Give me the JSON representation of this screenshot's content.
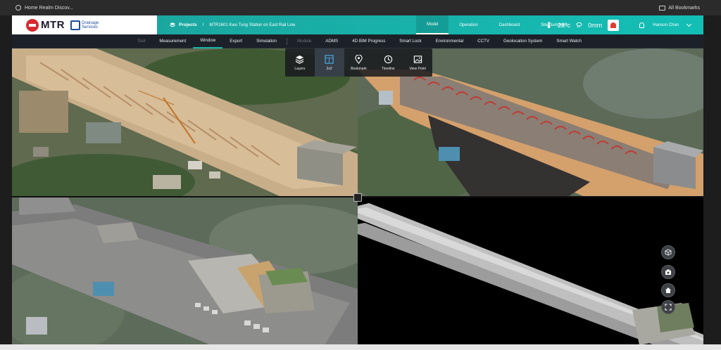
{
  "browser": {
    "bookmark_label": "Home Realm Discov...",
    "all_bookmarks_label": "All Bookmarks"
  },
  "header": {
    "brand": "MTR",
    "dept_logo_text": "Drainage Services",
    "breadcrumb_projects": "Projects",
    "breadcrumb_project": "MTR1601 Kwu Tung Station on East Rail Line",
    "nav": [
      {
        "label": "Model",
        "active": true
      },
      {
        "label": "Operation",
        "active": false
      },
      {
        "label": "Dashboard",
        "active": false
      },
      {
        "label": "Site Summary",
        "active": false
      }
    ],
    "temperature": "28°c",
    "rainfall": "0mm",
    "user_name": "Hanson Chan"
  },
  "submenu": [
    {
      "label": "Tool",
      "dim": true
    },
    {
      "label": "Measurement",
      "dim": false
    },
    {
      "label": "Window",
      "dim": false,
      "active": true
    },
    {
      "label": "Export",
      "dim": false
    },
    {
      "label": "Simulation",
      "dim": false
    },
    {
      "label": "Module",
      "dim": true
    },
    {
      "label": "ADMS",
      "dim": false
    },
    {
      "label": "4D BIM Progress",
      "dim": false
    },
    {
      "label": "Smart Lock",
      "dim": false
    },
    {
      "label": "Environmental",
      "dim": false
    },
    {
      "label": "CCTV",
      "dim": false
    },
    {
      "label": "Geolocation System",
      "dim": false
    },
    {
      "label": "Smart Watch",
      "dim": false
    }
  ],
  "toolbar": {
    "items": [
      {
        "label": "Layers",
        "icon": "layers-icon"
      },
      {
        "label": "2x2",
        "icon": "grid-icon",
        "active": true
      },
      {
        "label": "Bookmark",
        "icon": "pin-icon"
      },
      {
        "label": "Timeline",
        "icon": "clock-icon"
      },
      {
        "label": "View Point",
        "icon": "image-icon"
      }
    ]
  },
  "side_tools": [
    "cube-icon",
    "camera-icon",
    "home-icon",
    "fullscreen-icon"
  ],
  "colors": {
    "accent_teal": "#17b5ad",
    "selected_viewport_border": "#2d7fd3",
    "mtr_red": "#d42a2f"
  }
}
